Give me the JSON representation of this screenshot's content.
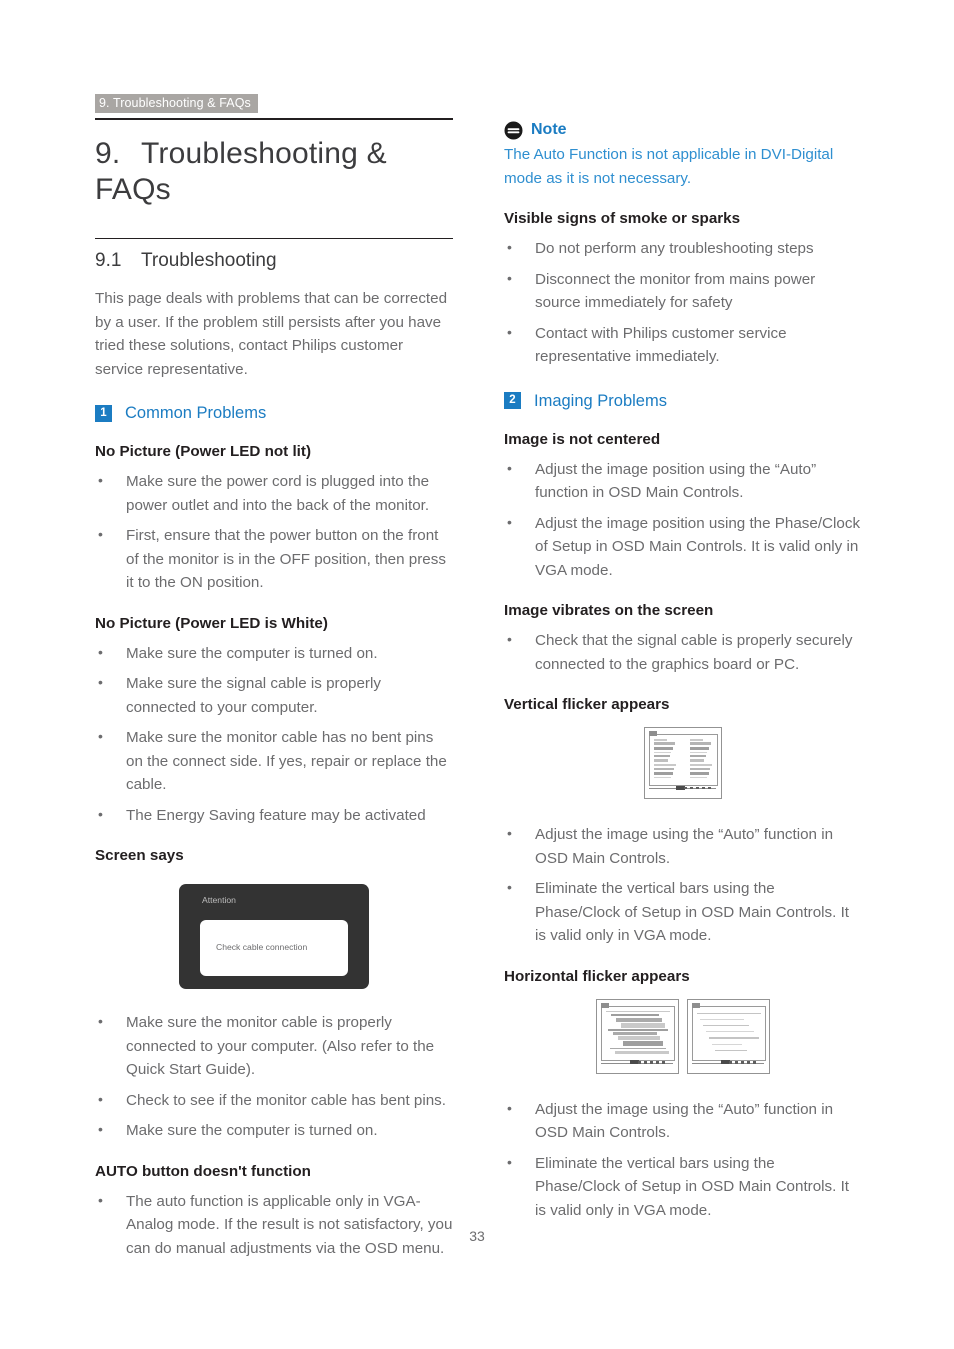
{
  "running_header": "9. Troubleshooting & FAQs",
  "chapter": {
    "number": "9.",
    "title": "Troubleshooting & FAQs"
  },
  "section": {
    "number": "9.1",
    "title": "Troubleshooting"
  },
  "intro": "This page deals with problems that can be corrected by a user. If the problem still persists after you have tried these solutions, contact Philips customer service representative.",
  "subheads": {
    "common_problems": {
      "badge": "1",
      "label": "Common Problems"
    },
    "imaging_problems": {
      "badge": "2",
      "label": "Imaging Problems"
    }
  },
  "left_column": {
    "q1": {
      "heading": "No Picture (Power LED not lit)",
      "bullets": [
        "Make sure the power cord is plugged into the power outlet and into the back of the monitor.",
        "First, ensure that the power button on the front of the monitor is in the OFF position, then press it to the ON position."
      ]
    },
    "q2": {
      "heading": "No Picture (Power LED is White)",
      "bullets": [
        "Make sure the computer is turned on.",
        "Make sure the signal cable is properly connected to your computer.",
        "Make sure the monitor cable has no bent pins on the connect side. If yes, repair or replace the cable.",
        "The Energy Saving feature may be activated"
      ]
    },
    "q3": {
      "heading": "Screen says",
      "osd": {
        "title": "Attention",
        "message": "Check cable connection"
      },
      "bullets": [
        "Make sure the monitor cable is properly connected to your computer. (Also refer to the Quick Start Guide).",
        "Check to see if the monitor cable has bent pins.",
        "Make sure the computer is turned on."
      ]
    },
    "q4": {
      "heading": "AUTO button doesn't function",
      "bullets": [
        "The auto function is applicable only in VGA-Analog mode.  If the result is not satisfactory, you can do manual adjustments via the OSD menu."
      ]
    }
  },
  "note": {
    "icon": "note-icon",
    "title": "Note",
    "body": "The Auto Function is not applicable in DVI-Digital mode as it is not necessary."
  },
  "right_column": {
    "q5": {
      "heading": "Visible signs of smoke or sparks",
      "bullets": [
        "Do not perform any troubleshooting steps",
        "Disconnect the monitor from mains power source immediately for safety",
        "Contact with Philips customer service representative immediately."
      ]
    },
    "q6": {
      "heading": "Image is not centered",
      "bullets": [
        "Adjust the image position using the “Auto” function in OSD Main Controls.",
        "Adjust the image position using the Phase/Clock of Setup in OSD Main Controls.  It is valid only in VGA mode."
      ]
    },
    "q7": {
      "heading": "Image vibrates on the screen",
      "bullets": [
        "Check that the signal cable is properly securely connected to the graphics board or PC."
      ]
    },
    "q8": {
      "heading": "Vertical flicker appears",
      "figure": "vertical-flicker-diagram",
      "bullets": [
        "Adjust the image using the “Auto” function in OSD Main Controls.",
        "Eliminate the vertical bars using the Phase/Clock of Setup in OSD Main Controls. It is valid only in VGA mode."
      ]
    },
    "q9": {
      "heading": "Horizontal flicker appears",
      "figure": "horizontal-flicker-diagram",
      "bullets": [
        "Adjust the image using the “Auto” function in OSD Main Controls.",
        "Eliminate the vertical bars using the Phase/Clock of Setup in OSD Main Controls. It is valid only in VGA mode."
      ]
    }
  },
  "page_number": "33",
  "colors": {
    "accent_blue": "#1b7cc2",
    "note_blue": "#2f8fd0",
    "header_gray": "#a9a6a3",
    "body_gray": "#6c6c6e",
    "heading_black": "#231f20",
    "osd_dark": "#333333"
  }
}
